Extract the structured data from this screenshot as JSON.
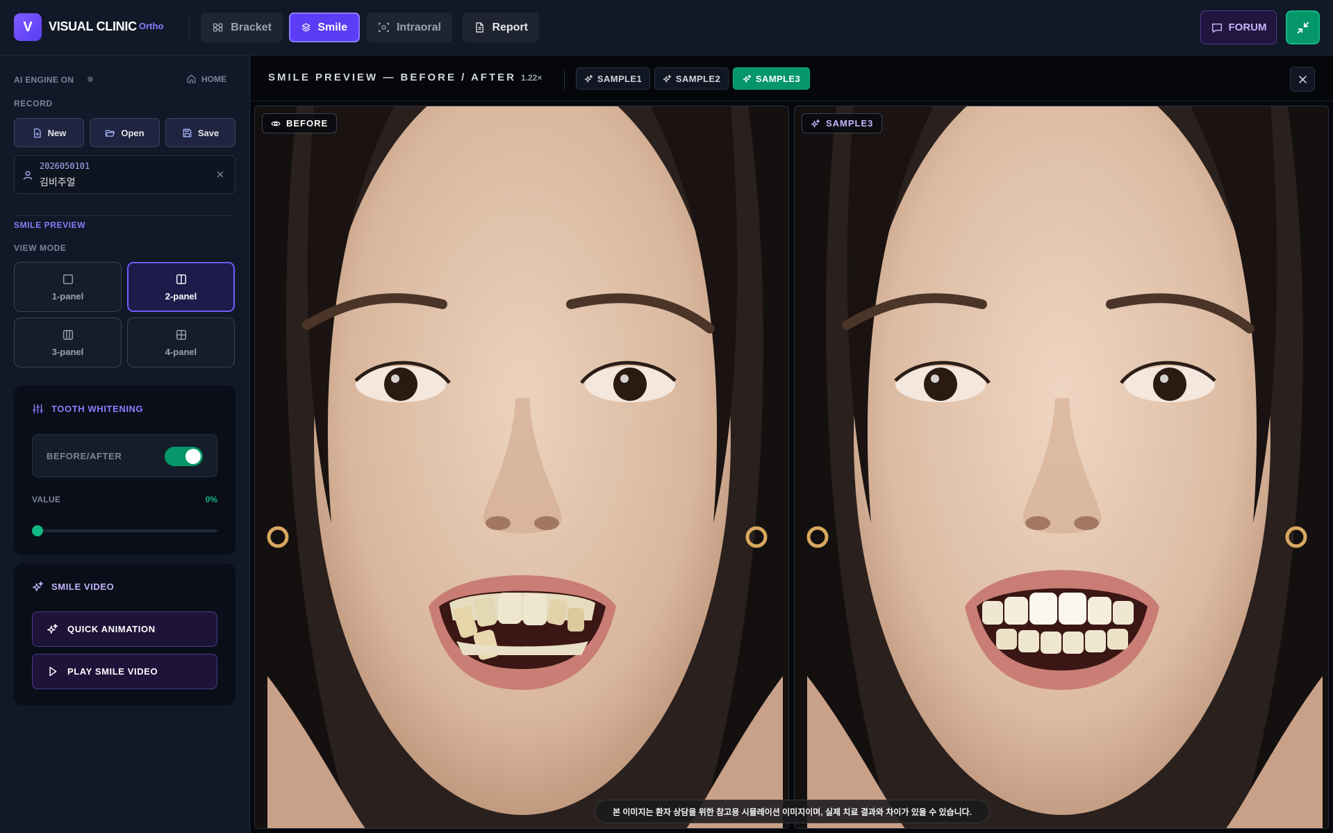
{
  "app": {
    "logo_letter": "V",
    "brand": "VISUAL CLINIC",
    "brand_sub": "Ortho"
  },
  "nav": {
    "tabs": [
      {
        "label": "Bracket",
        "icon": "bracket-grid-icon",
        "active": false
      },
      {
        "label": "Smile",
        "icon": "layers-icon",
        "active": true
      },
      {
        "label": "Intraoral",
        "icon": "scan-icon",
        "active": false
      },
      {
        "label": "Report",
        "icon": "document-icon",
        "active": false
      }
    ],
    "forum_label": "FORUM"
  },
  "sidebar": {
    "engine_label": "AI ENGINE ON",
    "home_label": "HOME",
    "record_label": "RECORD",
    "record_buttons": [
      {
        "label": "New",
        "icon": "file-plus-icon"
      },
      {
        "label": "Open",
        "icon": "folder-open-icon"
      },
      {
        "label": "Save",
        "icon": "save-icon"
      }
    ],
    "patient": {
      "id": "2026050101",
      "name": "김비주얼"
    },
    "smile_preview_label": "SMILE PREVIEW",
    "view_mode_label": "VIEW MODE",
    "view_modes": [
      {
        "label": "1-panel",
        "active": false
      },
      {
        "label": "2-panel",
        "active": true
      },
      {
        "label": "3-panel",
        "active": false
      },
      {
        "label": "4-panel",
        "active": false
      }
    ],
    "whitening": {
      "title": "TOOTH WHITENING",
      "toggle_label": "BEFORE/AFTER",
      "toggle_on": true,
      "value_label": "VALUE",
      "value_text": "0%",
      "value": 0
    },
    "video": {
      "title": "SMILE VIDEO",
      "quick_label": "QUICK ANIMATION",
      "play_label": "PLAY SMILE VIDEO"
    }
  },
  "main": {
    "title": "SMILE PREVIEW — BEFORE / AFTER",
    "zoom": "1.22×",
    "samples": [
      {
        "label": "SAMPLE1",
        "active": false
      },
      {
        "label": "SAMPLE2",
        "active": false
      },
      {
        "label": "SAMPLE3",
        "active": true
      }
    ],
    "left_badge": "BEFORE",
    "right_badge": "SAMPLE3",
    "disclaimer": "본 이미지는 환자 상담을 위한 참고용 시뮬레이션 이미지이며, 실제 치료 결과와 차이가 있을 수 있습니다."
  },
  "colors": {
    "accent": "#5b3df5",
    "success": "#059669",
    "panel_bg": "#0a0e18",
    "sidebar_bg": "#111827"
  }
}
